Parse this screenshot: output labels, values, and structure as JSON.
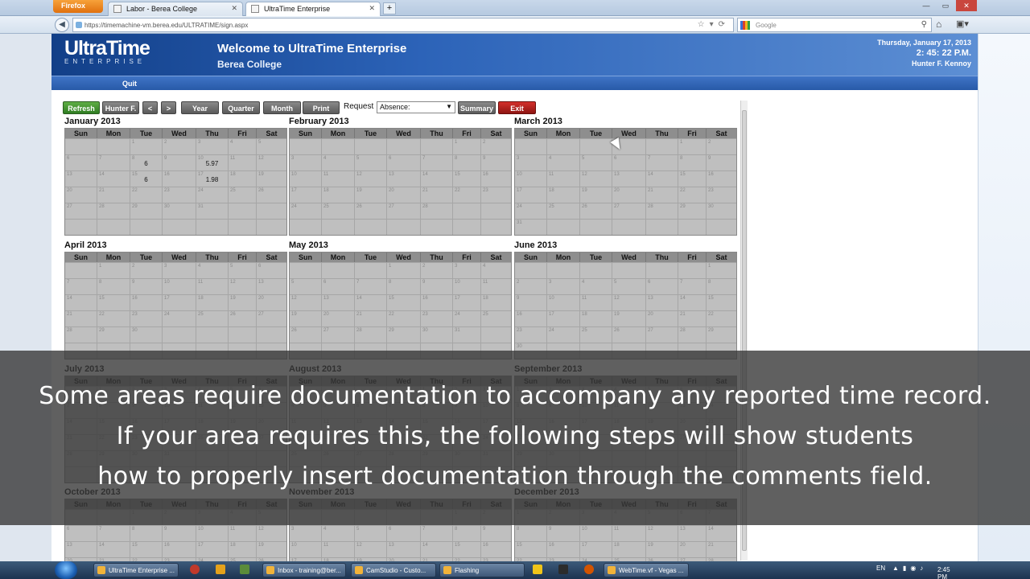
{
  "browser": {
    "app_button": "Firefox",
    "tabs": [
      {
        "label": "Labor - Berea College"
      },
      {
        "label": "UltraTime Enterprise"
      }
    ],
    "url": "https://timemachine-vm.berea.edu/ULTRATIME/sign.aspx",
    "search_placeholder": "Google"
  },
  "header": {
    "logo": "UltraTime",
    "logo_sub": "ENTERPRISE",
    "welcome": "Welcome to UltraTime Enterprise",
    "college": "Berea College",
    "date": "Thursday, January 17, 2013",
    "time": "2: 45: 22 P.M.",
    "user": "Hunter F. Kennoy"
  },
  "nav": {
    "quit": "Quit"
  },
  "toolbar": {
    "refresh": "Refresh",
    "person": "Hunter F.",
    "prev": "<",
    "next": ">",
    "year": "Year",
    "quarter": "Quarter",
    "month": "Month",
    "print": "Print",
    "request_label": "Request",
    "request_value": "Absence:",
    "summary": "Summary",
    "exit": "Exit"
  },
  "day_headers": [
    "Sun",
    "Mon",
    "Tue",
    "Wed",
    "Thu",
    "Fri",
    "Sat"
  ],
  "months": [
    {
      "title": "January 2013",
      "start": 2,
      "days": 31,
      "hours": {
        "8": "6",
        "10": "5.97",
        "15": "6",
        "17": "1.98"
      }
    },
    {
      "title": "February 2013",
      "start": 5,
      "days": 28,
      "hours": {}
    },
    {
      "title": "March 2013",
      "start": 5,
      "days": 31,
      "hours": {}
    },
    {
      "title": "April 2013",
      "start": 1,
      "days": 30,
      "hours": {}
    },
    {
      "title": "May 2013",
      "start": 3,
      "days": 31,
      "hours": {}
    },
    {
      "title": "June 2013",
      "start": 6,
      "days": 30,
      "hours": {}
    },
    {
      "title": "July 2013",
      "start": 1,
      "days": 31,
      "hours": {}
    },
    {
      "title": "August 2013",
      "start": 4,
      "days": 31,
      "hours": {}
    },
    {
      "title": "September 2013",
      "start": 0,
      "days": 30,
      "hours": {}
    },
    {
      "title": "October 2013",
      "start": 2,
      "days": 31,
      "hours": {}
    },
    {
      "title": "November 2013",
      "start": 5,
      "days": 30,
      "hours": {}
    },
    {
      "title": "December 2013",
      "start": 0,
      "days": 31,
      "hours": {}
    }
  ],
  "caption": {
    "line1": "Some areas require documentation to accompany any reported time record.",
    "line2": "If your area requires this, the following steps will show students",
    "line3": "how to properly insert documentation through the comments field."
  },
  "taskbar": {
    "tasks": [
      {
        "label": "UltraTime Enterprise ..."
      },
      {
        "label": "Inbox - training@ber..."
      },
      {
        "label": "CamStudio - Custo..."
      },
      {
        "label": "Flashing"
      },
      {
        "label": "WebTime.vf - Vegas ..."
      }
    ],
    "lang": "EN",
    "clock": "2:45 PM"
  }
}
